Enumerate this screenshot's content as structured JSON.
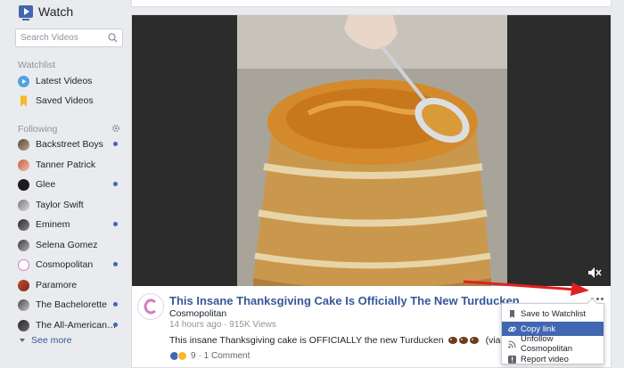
{
  "sidebar": {
    "title": "Watch",
    "search_placeholder": "Search Videos",
    "watchlist_label": "Watchlist",
    "watchlist_items": [
      {
        "label": "Latest Videos",
        "icon": "play-circle-icon"
      },
      {
        "label": "Saved Videos",
        "icon": "bookmark-icon"
      }
    ],
    "following_label": "Following",
    "following_items": [
      {
        "label": "Backstreet Boys",
        "new": true
      },
      {
        "label": "Tanner Patrick",
        "new": false
      },
      {
        "label": "Glee",
        "new": true
      },
      {
        "label": "Taylor Swift",
        "new": false
      },
      {
        "label": "Eminem",
        "new": true
      },
      {
        "label": "Selena Gomez",
        "new": false
      },
      {
        "label": "Cosmopolitan",
        "new": true
      },
      {
        "label": "Paramore",
        "new": false
      },
      {
        "label": "The Bachelorette",
        "new": true
      },
      {
        "label": "The All-American R…",
        "new": true
      }
    ],
    "see_more": "See more"
  },
  "post": {
    "title": "This Insane Thanksgiving Cake Is Officially The New Turducken",
    "publisher": "Cosmopolitan",
    "meta": "14 hours ago · 915K Views",
    "description": "This insane Thanksgiving cake is OFFICIALLY the new Turducken",
    "description_suffix": "(via Delish)",
    "reaction_count": "9",
    "comment_count": "· 1 Comment"
  },
  "menu": {
    "items": [
      {
        "label": "Save to Watchlist",
        "icon": "bookmark-icon",
        "active": false
      },
      {
        "label": "Copy link",
        "icon": "link-icon",
        "active": true
      },
      {
        "label": "Unfollow Cosmopolitan",
        "icon": "rss-icon",
        "active": false
      },
      {
        "label": "Report video",
        "icon": "flag-icon",
        "active": false
      }
    ]
  },
  "colors": {
    "accent": "#4267b2",
    "link": "#365899",
    "arrow": "#e02020"
  }
}
